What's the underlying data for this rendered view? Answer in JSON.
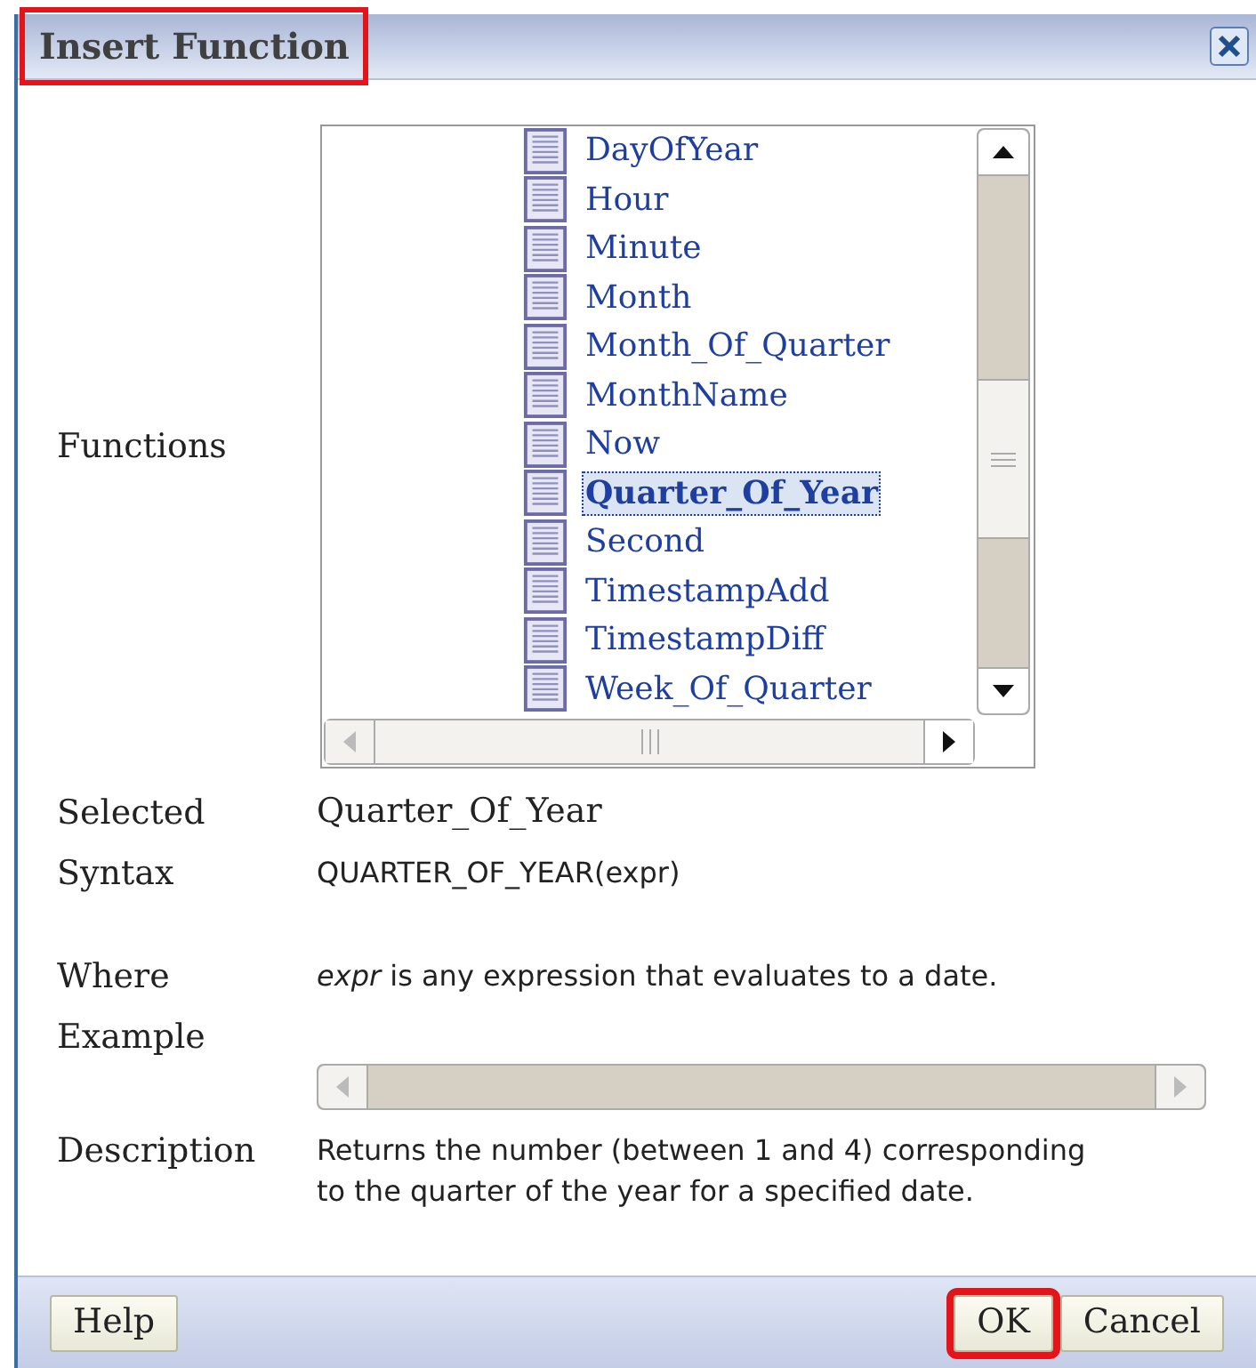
{
  "window": {
    "title": "Insert Function",
    "title_highlighted": true
  },
  "functions_label": "Functions",
  "functions": [
    {
      "label": "DayOfYear",
      "selected": false
    },
    {
      "label": "Hour",
      "selected": false
    },
    {
      "label": "Minute",
      "selected": false
    },
    {
      "label": "Month",
      "selected": false
    },
    {
      "label": "Month_Of_Quarter",
      "selected": false
    },
    {
      "label": "MonthName",
      "selected": false
    },
    {
      "label": "Now",
      "selected": false
    },
    {
      "label": "Quarter_Of_Year",
      "selected": true
    },
    {
      "label": "Second",
      "selected": false
    },
    {
      "label": "TimestampAdd",
      "selected": false
    },
    {
      "label": "TimestampDiff",
      "selected": false
    },
    {
      "label": "Week_Of_Quarter",
      "selected": false
    }
  ],
  "details": [
    {
      "label": "Selected",
      "value": "Quarter_Of_Year",
      "kind": "text"
    },
    {
      "label": "Syntax",
      "value": "QUARTER_OF_YEAR(expr)",
      "kind": "text"
    },
    {
      "label": "Where",
      "value": "*expr* is any expression that evaluates to a date.",
      "kind": "text"
    },
    {
      "label": "Example",
      "kind": "scroll"
    },
    {
      "label": "Description",
      "value": "Returns the number (between 1 and 4) corresponding to the quarter of the year for a specified date.",
      "kind": "text"
    }
  ],
  "buttons": [
    {
      "label": "Help",
      "highlighted": false
    },
    {
      "label": "OK",
      "highlighted": true
    },
    {
      "label": "Cancel",
      "highlighted": false
    }
  ]
}
